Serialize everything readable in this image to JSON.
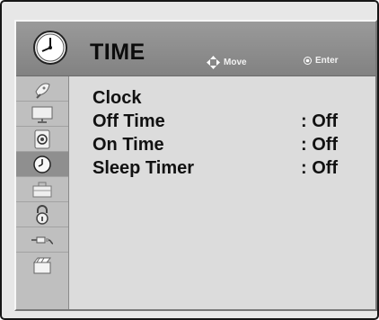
{
  "menu": {
    "title": "TIME",
    "hints": {
      "move_label": "Move",
      "enter_label": "Enter"
    },
    "items": [
      {
        "label": "Clock",
        "value": ""
      },
      {
        "label": "Off Time",
        "value": ": Off"
      },
      {
        "label": "On Time",
        "value": ": Off"
      },
      {
        "label": "Sleep Timer",
        "value": ": Off"
      }
    ]
  },
  "sidebar": {
    "selected_icon": "clock-icon",
    "icons": [
      "satellite-dish-icon",
      "monitor-icon",
      "speaker-icon",
      "clock-icon",
      "toolbox-icon",
      "lock-icon",
      "cable-icon",
      "clapperboard-icon"
    ]
  },
  "colors": {
    "header_gradient_top": "#9a9a9a",
    "header_gradient_bottom": "#828282",
    "sidebar_active": "#8f8f8f",
    "text": "#111111"
  }
}
